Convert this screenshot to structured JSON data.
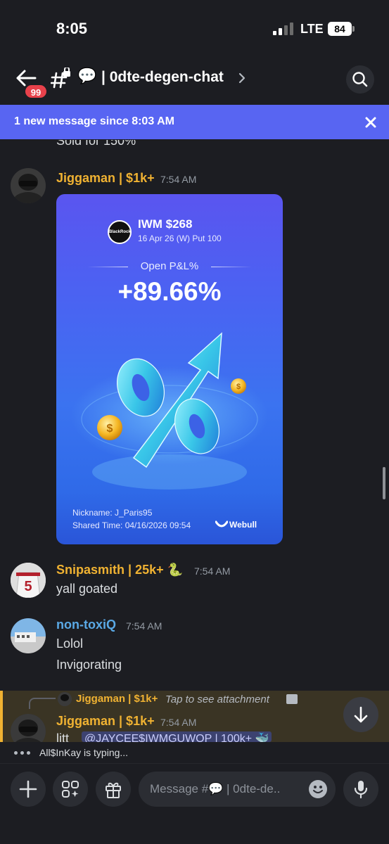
{
  "status": {
    "time": "8:05",
    "network": "LTE",
    "battery": "84"
  },
  "header": {
    "unread_badge": "99",
    "channel_emoji": "💬",
    "channel_title": "| 0dte-degen-chat"
  },
  "new_messages_bar": {
    "text": "1 new message since 8:03 AM"
  },
  "messages": {
    "partial_text": "Sold for 150%",
    "m1": {
      "username": "Jiggaman | $1k+",
      "time": "7:54 AM",
      "card": {
        "logo_text": "BlackRock",
        "ticker": "IWM $268",
        "contract": "16 Apr 26 (W) Put 100",
        "pl_label": "Open P&L%",
        "pl_value": "+89.66%",
        "nickname": "Nickname: J_Paris95",
        "shared_time": "Shared Time: 04/16/2026 09:54",
        "brand": "Webull"
      }
    },
    "m2": {
      "username": "Snipasmith | 25k+ 🐍",
      "time": "7:54 AM",
      "text": "yall goated"
    },
    "m3": {
      "username": "non-toxiQ",
      "time": "7:54 AM",
      "lines": [
        "Lolol",
        "Invigorating"
      ]
    },
    "m4": {
      "reply_username": "Jiggaman | $1k+",
      "reply_text": "Tap to see attachment",
      "username": "Jiggaman | $1k+",
      "time": "7:54 AM",
      "text_start": "litt",
      "mention": "@JAYCEE$IWMGUWOP | 100k+ 🐳"
    }
  },
  "typing": {
    "text": "All$InKay is typing..."
  },
  "composer": {
    "placeholder": "Message #💬 | 0dte-de.."
  },
  "colors": {
    "accent": "#5865f2",
    "username_gold": "#f0b232",
    "username_blue": "#5aa9e6",
    "badge_red": "#e8414b"
  }
}
